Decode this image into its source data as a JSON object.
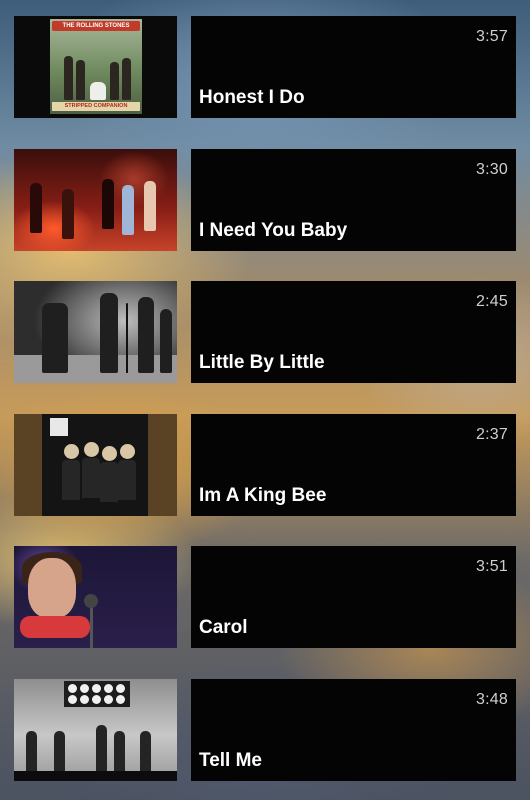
{
  "playlist": {
    "items": [
      {
        "title": "Honest I Do",
        "duration": "3:57",
        "cover_top_text": "THE ROLLING STONES",
        "cover_bottom_text": "STRIPPED COMPANION"
      },
      {
        "title": "I Need You Baby",
        "duration": "3:30"
      },
      {
        "title": "Little By Little",
        "duration": "2:45"
      },
      {
        "title": "Im A King Bee",
        "duration": "2:37"
      },
      {
        "title": "Carol",
        "duration": "3:51"
      },
      {
        "title": "Tell Me",
        "duration": "3:48"
      }
    ]
  },
  "colors": {
    "panel_background": "#040404",
    "title_text": "#ffffff",
    "duration_text": "#cfcfcf"
  }
}
